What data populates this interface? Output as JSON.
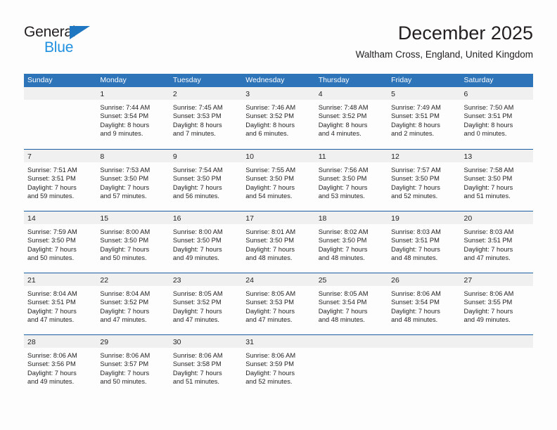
{
  "logo": {
    "word1": "General",
    "word2": "Blue",
    "triangle_color": "#1f77c1",
    "word2_color": "#1f8fe0"
  },
  "header": {
    "title": "December 2025",
    "subtitle": "Waltham Cross, England, United Kingdom"
  },
  "colors": {
    "header_blue": "#2e74b8",
    "row_separator": "#1a5fa0",
    "day_band": "#f0f0f0",
    "text": "#231f20"
  },
  "calendar": {
    "weekdays": [
      "Sunday",
      "Monday",
      "Tuesday",
      "Wednesday",
      "Thursday",
      "Friday",
      "Saturday"
    ],
    "weeks": [
      [
        {
          "day": "",
          "sunrise": "",
          "sunset": "",
          "daylight1": "",
          "daylight2": ""
        },
        {
          "day": "1",
          "sunrise": "Sunrise: 7:44 AM",
          "sunset": "Sunset: 3:54 PM",
          "daylight1": "Daylight: 8 hours",
          "daylight2": "and 9 minutes."
        },
        {
          "day": "2",
          "sunrise": "Sunrise: 7:45 AM",
          "sunset": "Sunset: 3:53 PM",
          "daylight1": "Daylight: 8 hours",
          "daylight2": "and 7 minutes."
        },
        {
          "day": "3",
          "sunrise": "Sunrise: 7:46 AM",
          "sunset": "Sunset: 3:52 PM",
          "daylight1": "Daylight: 8 hours",
          "daylight2": "and 6 minutes."
        },
        {
          "day": "4",
          "sunrise": "Sunrise: 7:48 AM",
          "sunset": "Sunset: 3:52 PM",
          "daylight1": "Daylight: 8 hours",
          "daylight2": "and 4 minutes."
        },
        {
          "day": "5",
          "sunrise": "Sunrise: 7:49 AM",
          "sunset": "Sunset: 3:51 PM",
          "daylight1": "Daylight: 8 hours",
          "daylight2": "and 2 minutes."
        },
        {
          "day": "6",
          "sunrise": "Sunrise: 7:50 AM",
          "sunset": "Sunset: 3:51 PM",
          "daylight1": "Daylight: 8 hours",
          "daylight2": "and 0 minutes."
        }
      ],
      [
        {
          "day": "7",
          "sunrise": "Sunrise: 7:51 AM",
          "sunset": "Sunset: 3:51 PM",
          "daylight1": "Daylight: 7 hours",
          "daylight2": "and 59 minutes."
        },
        {
          "day": "8",
          "sunrise": "Sunrise: 7:53 AM",
          "sunset": "Sunset: 3:50 PM",
          "daylight1": "Daylight: 7 hours",
          "daylight2": "and 57 minutes."
        },
        {
          "day": "9",
          "sunrise": "Sunrise: 7:54 AM",
          "sunset": "Sunset: 3:50 PM",
          "daylight1": "Daylight: 7 hours",
          "daylight2": "and 56 minutes."
        },
        {
          "day": "10",
          "sunrise": "Sunrise: 7:55 AM",
          "sunset": "Sunset: 3:50 PM",
          "daylight1": "Daylight: 7 hours",
          "daylight2": "and 54 minutes."
        },
        {
          "day": "11",
          "sunrise": "Sunrise: 7:56 AM",
          "sunset": "Sunset: 3:50 PM",
          "daylight1": "Daylight: 7 hours",
          "daylight2": "and 53 minutes."
        },
        {
          "day": "12",
          "sunrise": "Sunrise: 7:57 AM",
          "sunset": "Sunset: 3:50 PM",
          "daylight1": "Daylight: 7 hours",
          "daylight2": "and 52 minutes."
        },
        {
          "day": "13",
          "sunrise": "Sunrise: 7:58 AM",
          "sunset": "Sunset: 3:50 PM",
          "daylight1": "Daylight: 7 hours",
          "daylight2": "and 51 minutes."
        }
      ],
      [
        {
          "day": "14",
          "sunrise": "Sunrise: 7:59 AM",
          "sunset": "Sunset: 3:50 PM",
          "daylight1": "Daylight: 7 hours",
          "daylight2": "and 50 minutes."
        },
        {
          "day": "15",
          "sunrise": "Sunrise: 8:00 AM",
          "sunset": "Sunset: 3:50 PM",
          "daylight1": "Daylight: 7 hours",
          "daylight2": "and 50 minutes."
        },
        {
          "day": "16",
          "sunrise": "Sunrise: 8:00 AM",
          "sunset": "Sunset: 3:50 PM",
          "daylight1": "Daylight: 7 hours",
          "daylight2": "and 49 minutes."
        },
        {
          "day": "17",
          "sunrise": "Sunrise: 8:01 AM",
          "sunset": "Sunset: 3:50 PM",
          "daylight1": "Daylight: 7 hours",
          "daylight2": "and 48 minutes."
        },
        {
          "day": "18",
          "sunrise": "Sunrise: 8:02 AM",
          "sunset": "Sunset: 3:50 PM",
          "daylight1": "Daylight: 7 hours",
          "daylight2": "and 48 minutes."
        },
        {
          "day": "19",
          "sunrise": "Sunrise: 8:03 AM",
          "sunset": "Sunset: 3:51 PM",
          "daylight1": "Daylight: 7 hours",
          "daylight2": "and 48 minutes."
        },
        {
          "day": "20",
          "sunrise": "Sunrise: 8:03 AM",
          "sunset": "Sunset: 3:51 PM",
          "daylight1": "Daylight: 7 hours",
          "daylight2": "and 47 minutes."
        }
      ],
      [
        {
          "day": "21",
          "sunrise": "Sunrise: 8:04 AM",
          "sunset": "Sunset: 3:51 PM",
          "daylight1": "Daylight: 7 hours",
          "daylight2": "and 47 minutes."
        },
        {
          "day": "22",
          "sunrise": "Sunrise: 8:04 AM",
          "sunset": "Sunset: 3:52 PM",
          "daylight1": "Daylight: 7 hours",
          "daylight2": "and 47 minutes."
        },
        {
          "day": "23",
          "sunrise": "Sunrise: 8:05 AM",
          "sunset": "Sunset: 3:52 PM",
          "daylight1": "Daylight: 7 hours",
          "daylight2": "and 47 minutes."
        },
        {
          "day": "24",
          "sunrise": "Sunrise: 8:05 AM",
          "sunset": "Sunset: 3:53 PM",
          "daylight1": "Daylight: 7 hours",
          "daylight2": "and 47 minutes."
        },
        {
          "day": "25",
          "sunrise": "Sunrise: 8:05 AM",
          "sunset": "Sunset: 3:54 PM",
          "daylight1": "Daylight: 7 hours",
          "daylight2": "and 48 minutes."
        },
        {
          "day": "26",
          "sunrise": "Sunrise: 8:06 AM",
          "sunset": "Sunset: 3:54 PM",
          "daylight1": "Daylight: 7 hours",
          "daylight2": "and 48 minutes."
        },
        {
          "day": "27",
          "sunrise": "Sunrise: 8:06 AM",
          "sunset": "Sunset: 3:55 PM",
          "daylight1": "Daylight: 7 hours",
          "daylight2": "and 49 minutes."
        }
      ],
      [
        {
          "day": "28",
          "sunrise": "Sunrise: 8:06 AM",
          "sunset": "Sunset: 3:56 PM",
          "daylight1": "Daylight: 7 hours",
          "daylight2": "and 49 minutes."
        },
        {
          "day": "29",
          "sunrise": "Sunrise: 8:06 AM",
          "sunset": "Sunset: 3:57 PM",
          "daylight1": "Daylight: 7 hours",
          "daylight2": "and 50 minutes."
        },
        {
          "day": "30",
          "sunrise": "Sunrise: 8:06 AM",
          "sunset": "Sunset: 3:58 PM",
          "daylight1": "Daylight: 7 hours",
          "daylight2": "and 51 minutes."
        },
        {
          "day": "31",
          "sunrise": "Sunrise: 8:06 AM",
          "sunset": "Sunset: 3:59 PM",
          "daylight1": "Daylight: 7 hours",
          "daylight2": "and 52 minutes."
        },
        {
          "day": "",
          "sunrise": "",
          "sunset": "",
          "daylight1": "",
          "daylight2": ""
        },
        {
          "day": "",
          "sunrise": "",
          "sunset": "",
          "daylight1": "",
          "daylight2": ""
        },
        {
          "day": "",
          "sunrise": "",
          "sunset": "",
          "daylight1": "",
          "daylight2": ""
        }
      ]
    ]
  }
}
